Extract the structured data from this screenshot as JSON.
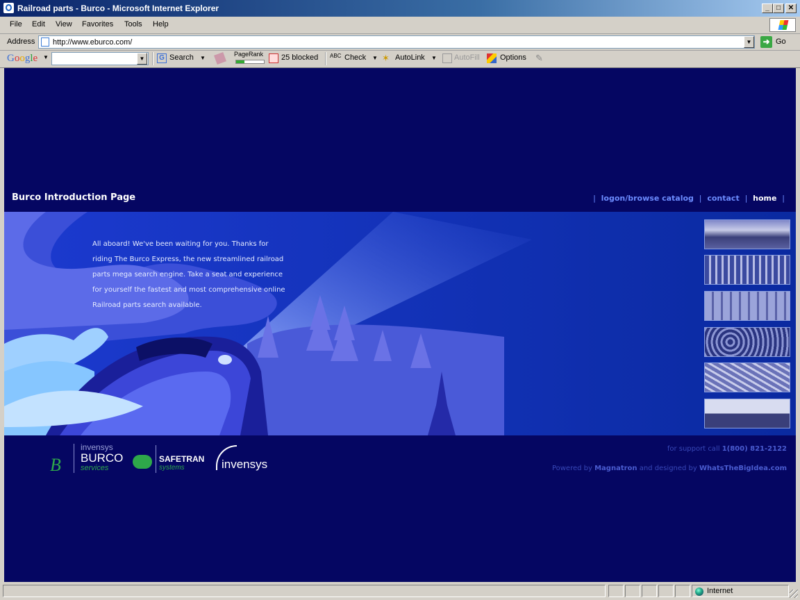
{
  "window": {
    "title": "Railroad parts - Burco - Microsoft Internet Explorer",
    "btn_min": "_",
    "btn_max": "□",
    "btn_close": "✕"
  },
  "menu": [
    "File",
    "Edit",
    "View",
    "Favorites",
    "Tools",
    "Help"
  ],
  "address": {
    "label": "Address",
    "url": "http://www.eburco.com/",
    "go_label": "Go"
  },
  "google_toolbar": {
    "logo": "Google",
    "search_label": "Search",
    "pagerank_label": "PageRank",
    "blocked_label": "25 blocked",
    "check_label": "Check",
    "autolink_label": "AutoLink",
    "autofill_label": "AutoFill",
    "options_label": "Options"
  },
  "page": {
    "title": "Burco Introduction Page",
    "nav": {
      "logon": "logon/browse catalog",
      "contact": "contact",
      "home": "home",
      "sep": "|"
    },
    "intro": "All aboard! We've been waiting for you. Thanks for riding The Burco Express, the new streamlined railroad parts mega search engine. Take a seat and experience for yourself the fastest and most comprehensive online Railroad parts search available.",
    "logos": {
      "burco_top": "invensys",
      "burco_name": "BURCO",
      "burco_sub": "services",
      "safetran_name": "SAFETRAN",
      "safetran_sub": "systems",
      "invensys_name": "invensys"
    },
    "support": {
      "text": "for support call ",
      "phone": "1(800) 821-2122"
    },
    "powered": {
      "pre": "Powered by ",
      "company": "Magnatron",
      "mid": " and designed by ",
      "designer": "WhatsTheBigIdea.com"
    }
  },
  "status": {
    "zone": "Internet"
  },
  "colors": {
    "page_bg": "#050662",
    "hero_bg": "#0a2aa0",
    "link": "#6c8cff",
    "footer_text": "#3848b8"
  }
}
